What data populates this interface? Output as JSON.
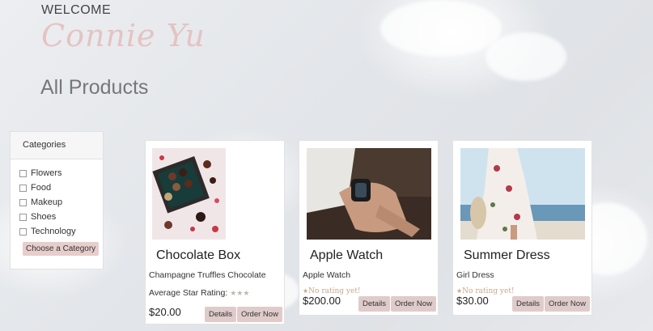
{
  "header": {
    "welcome": "WELCOME",
    "user_name": "Connie Yu",
    "page_title": "All Products"
  },
  "categories": {
    "title": "Categories",
    "items": [
      "Flowers",
      "Food",
      "Makeup",
      "Shoes",
      "Technology"
    ],
    "choose_label": "Choose a Category"
  },
  "products": [
    {
      "name": "Chocolate Box",
      "description": "Champagne Truffles Chocolate",
      "rating_label": "Average Star Rating:",
      "stars": "★★★",
      "price": "$20.00",
      "details_label": "Details",
      "order_label": "Order Now"
    },
    {
      "name": "Apple Watch",
      "description": "Apple Watch",
      "rating_label": "No rating yet!",
      "star": "★",
      "price": "$200.00",
      "details_label": "Details",
      "order_label": "Order Now"
    },
    {
      "name": "Summer Dress",
      "description": "Girl Dress",
      "rating_label": "No rating yet!",
      "star": "★",
      "price": "$30.00",
      "details_label": "Details",
      "order_label": "Order Now"
    }
  ],
  "colors": {
    "button_bg": "#e0cbcb",
    "name_script": "#e5c3c3",
    "no_rating": "#c9a58a"
  }
}
